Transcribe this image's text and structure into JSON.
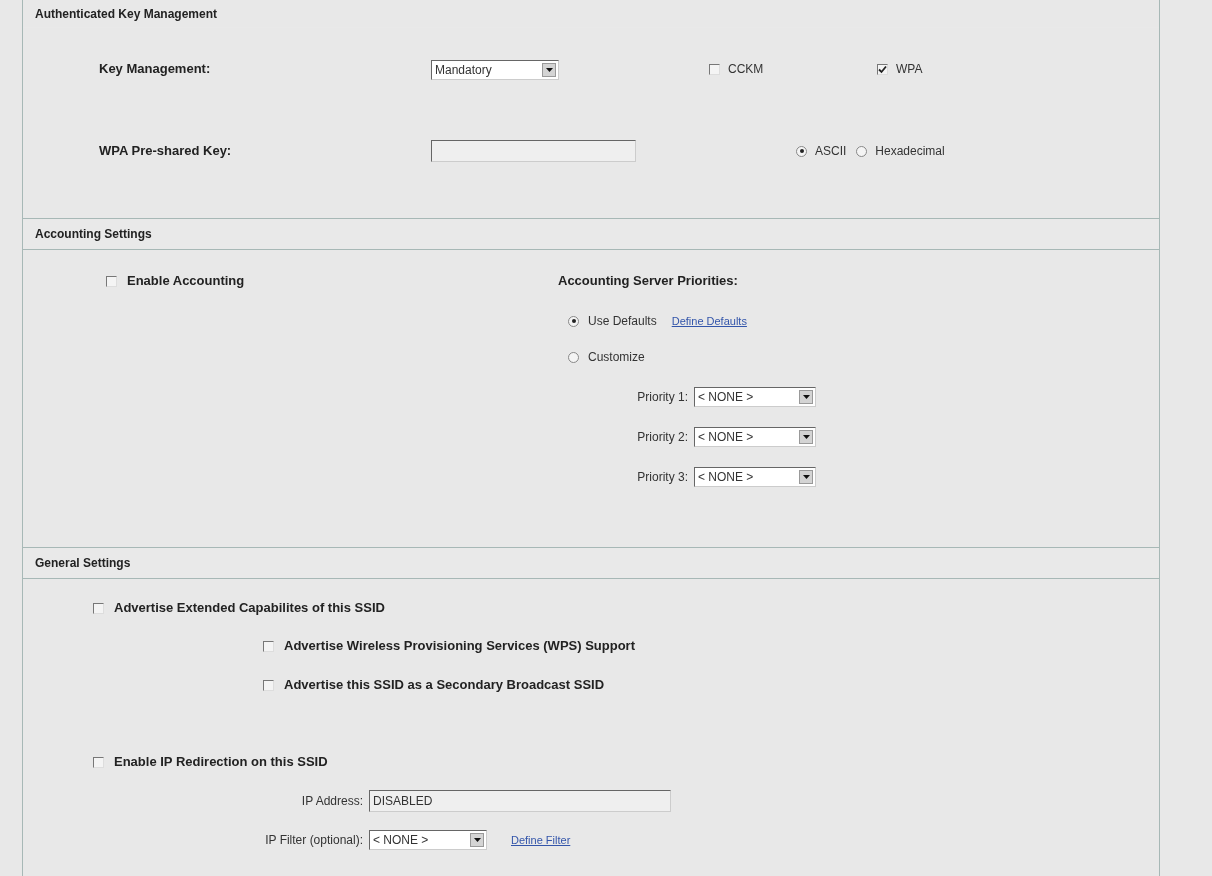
{
  "key_management": {
    "title": "Authenticated Key Management",
    "key_management_label": "Key Management:",
    "key_management_select": "Mandatory",
    "options": [
      {
        "label": "CCKM",
        "checked": false
      },
      {
        "label": "WPA",
        "checked": true
      }
    ],
    "psk_label": "WPA Pre-shared Key:",
    "key_format": [
      {
        "label": "ASCII",
        "selected": true
      },
      {
        "label": "Hexadecimal",
        "selected": false
      }
    ]
  },
  "accounting": {
    "title": "Accounting Settings",
    "enable_accounting": {
      "label": "Enable Accounting",
      "checked": false
    },
    "priorities_title": "Accounting Server Priorities:",
    "modes": [
      {
        "label": "Use Defaults",
        "selected": true,
        "link": "Define Defaults"
      },
      {
        "label": "Customize",
        "selected": false
      }
    ],
    "priorities": [
      {
        "label": "Priority 1:",
        "value": "< NONE >"
      },
      {
        "label": "Priority 2:",
        "value": "< NONE >"
      },
      {
        "label": "Priority 3:",
        "value": "< NONE >"
      }
    ]
  },
  "general": {
    "title": "General Settings",
    "advertise_extended": {
      "label": "Advertise Extended Capabilites of this SSID",
      "checked": false
    },
    "sub_options": [
      {
        "label": "Advertise Wireless Provisioning Services (WPS) Support",
        "checked": false
      },
      {
        "label": "Advertise this SSID as a Secondary Broadcast SSID",
        "checked": false
      }
    ],
    "ip_redirection": {
      "label": "Enable IP Redirection on this SSID",
      "checked": false
    },
    "ip_address_label": "IP Address:",
    "ip_address_value": "DISABLED",
    "ip_filter_label": "IP Filter (optional):",
    "ip_filter_value": "< NONE >",
    "ip_filter_link": "Define Filter"
  }
}
